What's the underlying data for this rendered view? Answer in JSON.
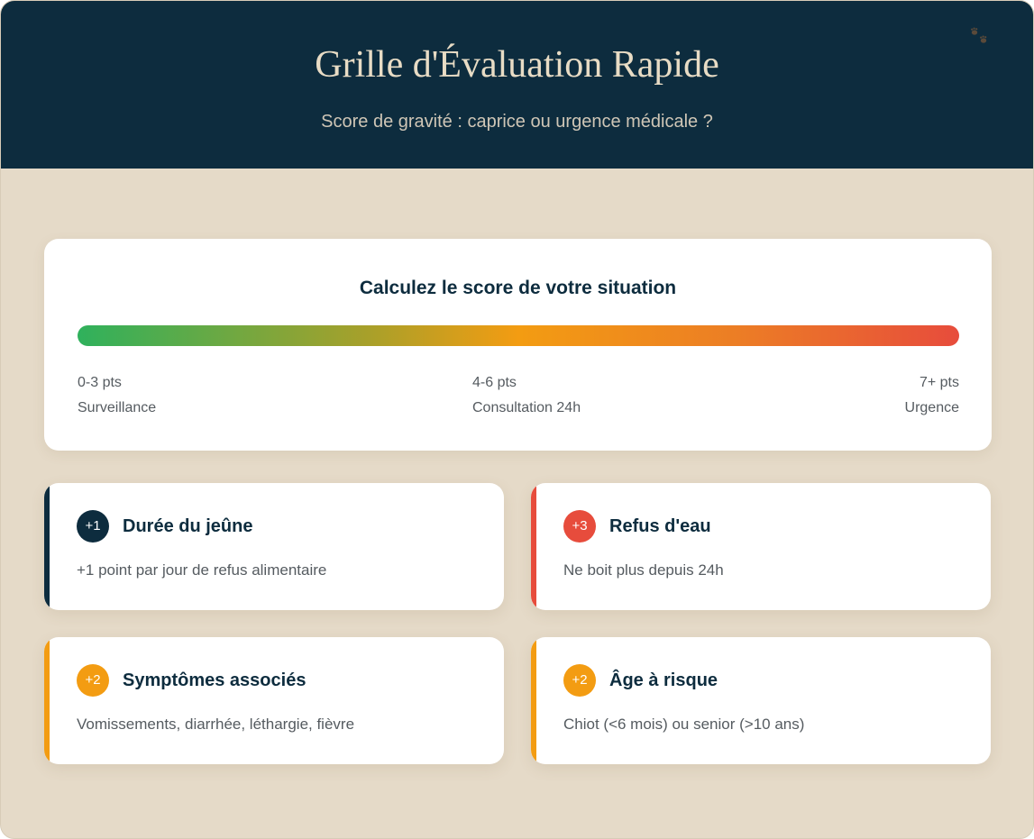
{
  "header": {
    "title": "Grille d'Évaluation Rapide",
    "subtitle": "Score de gravité : caprice ou urgence médicale ?",
    "decoration_icon": "paw-prints-icon"
  },
  "score": {
    "title": "Calculez le score de votre situation",
    "gauge_colors": [
      "#2fb15c",
      "#f39c12",
      "#e74c3c"
    ],
    "levels": [
      {
        "pts": "0-3 pts",
        "label": "Surveillance"
      },
      {
        "pts": "4-6 pts",
        "label": "Consultation 24h"
      },
      {
        "pts": "7+ pts",
        "label": "Urgence"
      }
    ]
  },
  "criteria": [
    {
      "badge": "+1",
      "title": "Durée du jeûne",
      "desc": "+1 point par jour de refus alimentaire",
      "color": "#0d2c3e"
    },
    {
      "badge": "+3",
      "title": "Refus d'eau",
      "desc": "Ne boit plus depuis 24h",
      "color": "#e74c3c"
    },
    {
      "badge": "+2",
      "title": "Symptômes associés",
      "desc": "Vomissements, diarrhée, léthargie, fièvre",
      "color": "#f39c12"
    },
    {
      "badge": "+2",
      "title": "Âge à risque",
      "desc": "Chiot (<6 mois) ou senior (>10 ans)",
      "color": "#f39c12"
    }
  ]
}
